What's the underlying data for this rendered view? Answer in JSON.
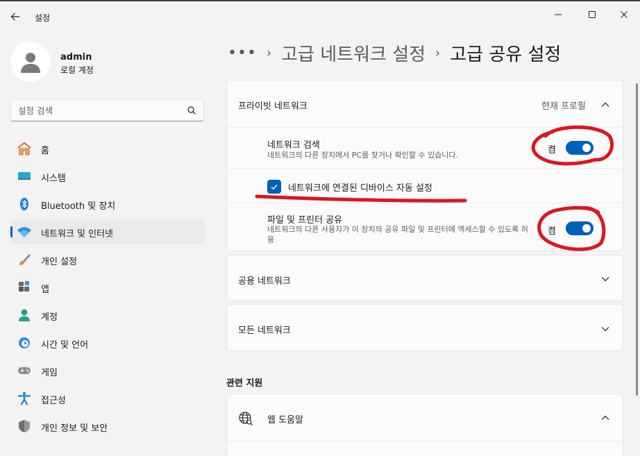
{
  "window": {
    "title": "설정",
    "back_icon": "back-arrow-icon",
    "controls": [
      "minimize-icon",
      "maximize-icon",
      "close-icon"
    ]
  },
  "profile": {
    "name": "admin",
    "account_type": "로컬 계정"
  },
  "search": {
    "placeholder": "설정 검색"
  },
  "sidebar": {
    "items": [
      {
        "label": "홈",
        "icon": "home-icon"
      },
      {
        "label": "시스템",
        "icon": "system-icon"
      },
      {
        "label": "Bluetooth 및 장치",
        "icon": "bluetooth-icon"
      },
      {
        "label": "네트워크 및 인터넷",
        "icon": "wifi-icon",
        "active": true
      },
      {
        "label": "개인 설정",
        "icon": "brush-icon"
      },
      {
        "label": "앱",
        "icon": "apps-icon"
      },
      {
        "label": "계정",
        "icon": "account-icon"
      },
      {
        "label": "시간 및 언어",
        "icon": "time-language-icon"
      },
      {
        "label": "게임",
        "icon": "gamepad-icon"
      },
      {
        "label": "접근성",
        "icon": "accessibility-icon"
      },
      {
        "label": "개인 정보 및 보안",
        "icon": "shield-icon"
      }
    ]
  },
  "breadcrumb": {
    "more": "•••",
    "parent": "고급 네트워크 설정",
    "current": "고급 공유 설정"
  },
  "private_network": {
    "title": "프라이빗 네트워크",
    "status": "현재 프로필",
    "expanded": true,
    "network_discovery": {
      "title": "네트워크 검색",
      "description": "네트워크의 다른 장치에서 PC를 찾거나 확인할 수 있습니다.",
      "state_label": "켬",
      "on": true
    },
    "auto_setup": {
      "label": "네트워크에 연결된 디바이스 자동 설정",
      "checked": true
    },
    "file_printer_sharing": {
      "title": "파일 및 프린터 공유",
      "description": "네트워크의 다른 사용자가 이 장치의 공유 파일 및 프린터에 액세스할 수 있도록 허용",
      "state_label": "켬",
      "on": true
    }
  },
  "public_network": {
    "title": "공용 네트워크"
  },
  "all_networks": {
    "title": "모든 네트워크"
  },
  "related": {
    "title": "관련 지원",
    "web_help": {
      "label": "웹 도움말",
      "icon": "globe-icon"
    }
  },
  "colors": {
    "accent": "#005fb8",
    "annotation": "#e0141e",
    "background": "#f3f3f3",
    "card": "#fbfbfb"
  }
}
